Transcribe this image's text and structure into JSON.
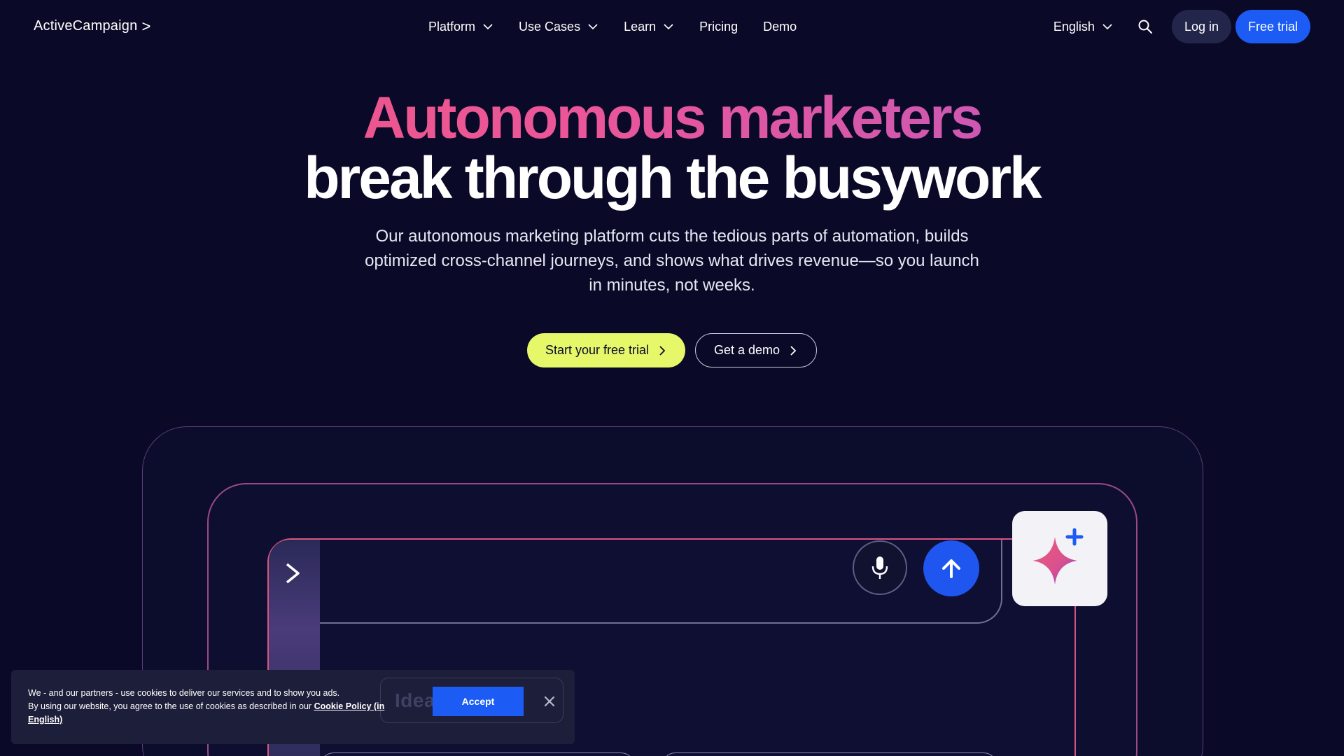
{
  "brand": {
    "name": "ActiveCampaign",
    "chevron": ">"
  },
  "nav": {
    "items": [
      {
        "label": "Platform",
        "has_dropdown": true
      },
      {
        "label": "Use Cases",
        "has_dropdown": true
      },
      {
        "label": "Learn",
        "has_dropdown": true
      },
      {
        "label": "Pricing",
        "has_dropdown": false
      },
      {
        "label": "Demo",
        "has_dropdown": false
      }
    ],
    "language": "English",
    "login_label": "Log in",
    "trial_label": "Free trial"
  },
  "hero": {
    "headline_line1": "Autonomous marketers",
    "headline_line2": "break through the busywork",
    "subtitle": "Our autonomous marketing platform cuts the tedious parts of automation, builds optimized cross-channel journeys, and shows what drives revenue—so you launch in minutes, not weeks.",
    "primary_cta": "Start your free trial",
    "secondary_cta": "Get a demo"
  },
  "illustration": {
    "icons": [
      "activecampaign-chevron-icon",
      "microphone-icon",
      "arrow-up-icon",
      "sparkle-icon"
    ],
    "ghost_text": "Idea t"
  },
  "cookie": {
    "line1": "We - and our partners - use cookies to deliver our services and to show you ads.",
    "line2_prefix": "By using our website, you agree to the use of cookies as described in our ",
    "policy_link": "Cookie Policy (in English)",
    "accept_label": "Accept"
  },
  "colors": {
    "background": "#0a0a28",
    "brand_blue": "#1c5cf5",
    "cta_lime": "#e6f76a",
    "headline_pink": "#f2577e",
    "headline_purple": "#b45ac8"
  }
}
